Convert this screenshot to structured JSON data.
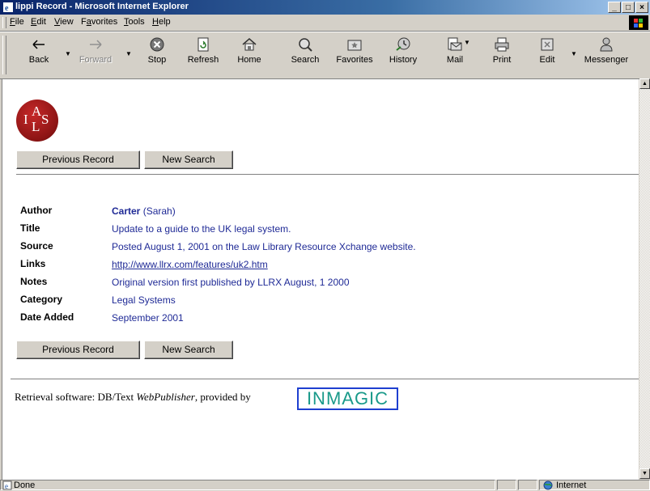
{
  "window": {
    "title": "lippi Record - Microsoft Internet Explorer",
    "controls": {
      "minimize": "_",
      "maximize": "□",
      "close": "×"
    }
  },
  "menu": [
    {
      "label": "File",
      "key": "F"
    },
    {
      "label": "Edit",
      "key": "E"
    },
    {
      "label": "View",
      "key": "V"
    },
    {
      "label": "Favorites",
      "key": "a"
    },
    {
      "label": "Tools",
      "key": "T"
    },
    {
      "label": "Help",
      "key": "H"
    }
  ],
  "toolbar": {
    "back": "Back",
    "forward": "Forward",
    "stop": "Stop",
    "refresh": "Refresh",
    "home": "Home",
    "search": "Search",
    "favorites": "Favorites",
    "history": "History",
    "mail": "Mail",
    "print": "Print",
    "edit": "Edit",
    "messenger": "Messenger"
  },
  "page": {
    "logo_letters": {
      "i": "I",
      "a": "A",
      "l": "L",
      "s": "S"
    },
    "buttons": {
      "previous": "Previous Record",
      "new_search": "New Search"
    },
    "record": {
      "author_label": "Author",
      "author_name": "Carter",
      "author_rest": " (Sarah)",
      "title_label": "Title",
      "title_value": "Update to a guide to the UK legal system.",
      "source_label": "Source",
      "source_value": "Posted August 1, 2001 on the Law Library Resource Xchange website.",
      "links_label": "Links",
      "links_value": "http://www.llrx.com/features/uk2.htm",
      "notes_label": "Notes",
      "notes_value": "Original version first published by LLRX August, 1 2000",
      "category_label": "Category",
      "category_value": "Legal Systems",
      "date_label": "Date Added",
      "date_value": "September 2001"
    },
    "footer": {
      "prefix": "Retrieval software: DB/Text ",
      "product": "WebPublisher",
      "suffix": ", provided by",
      "brand": "INMAGIC"
    }
  },
  "status": {
    "text": "Done",
    "zone": "Internet"
  },
  "colors": {
    "link": "#1f2a96",
    "logo_red": "#8b1414",
    "inmagic_border": "#1e3fd0",
    "inmagic_text": "#1a9a8a"
  }
}
